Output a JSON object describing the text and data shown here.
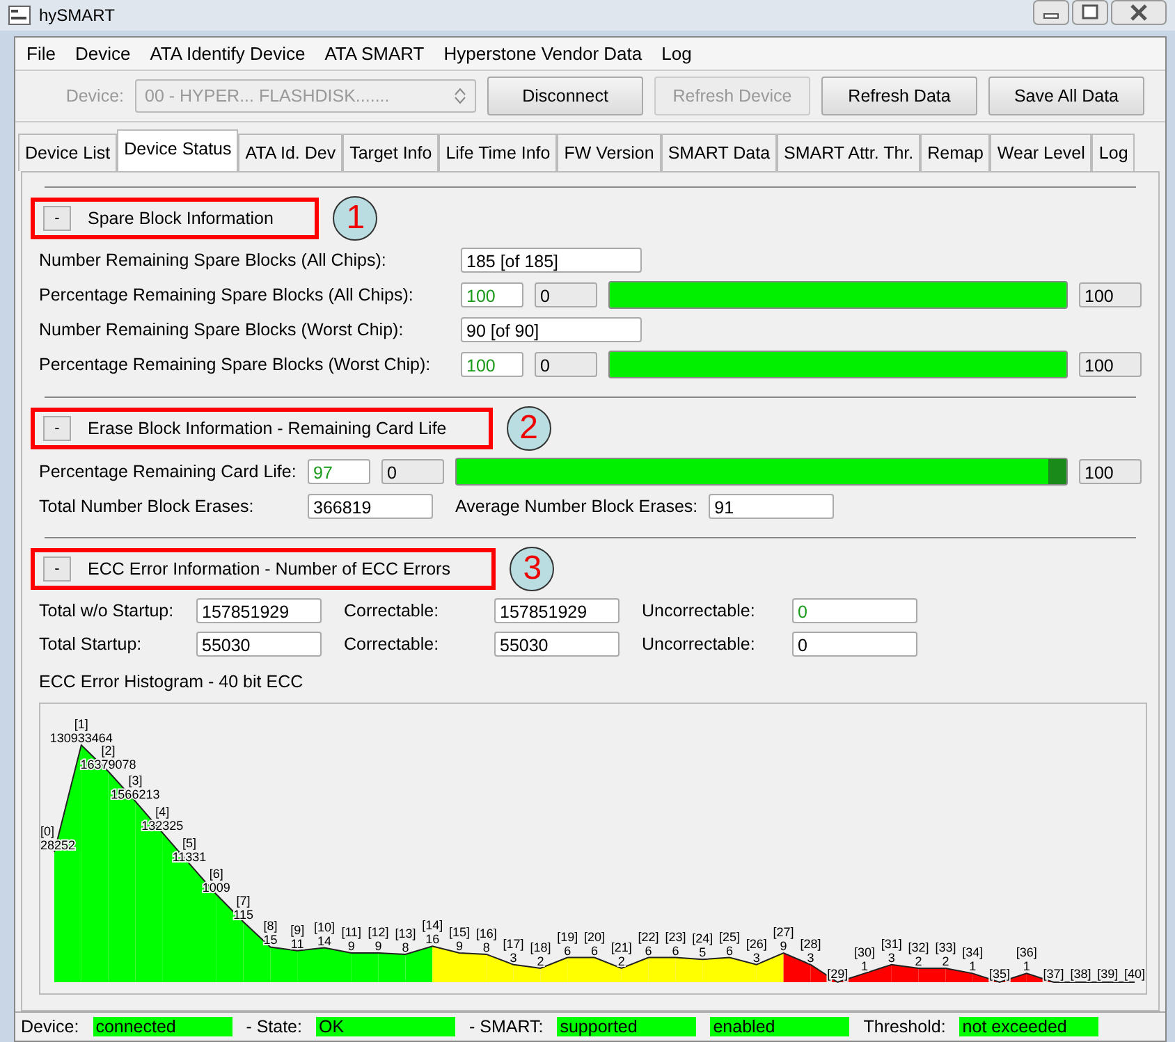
{
  "window": {
    "title": "hySMART"
  },
  "menu": [
    {
      "label": "File"
    },
    {
      "label": "Device"
    },
    {
      "label": "ATA Identify Device"
    },
    {
      "label": "ATA SMART"
    },
    {
      "label": "Hyperstone Vendor Data"
    },
    {
      "label": "Log"
    }
  ],
  "toolbar": {
    "device_label": "Device:",
    "device_value": "00 - HYPER... FLASHDISK.......",
    "device_disabled": true,
    "buttons": [
      {
        "label": "Disconnect",
        "disabled": false
      },
      {
        "label": "Refresh Device",
        "disabled": true
      },
      {
        "label": "Refresh Data",
        "disabled": false
      },
      {
        "label": "Save All Data",
        "disabled": false
      }
    ]
  },
  "tabs": [
    {
      "label": "Device List",
      "selected": false
    },
    {
      "label": "Device Status",
      "selected": true
    },
    {
      "label": "ATA Id. Dev",
      "selected": false
    },
    {
      "label": "Target Info",
      "selected": false
    },
    {
      "label": "Life Time Info",
      "selected": false
    },
    {
      "label": "FW Version",
      "selected": false
    },
    {
      "label": "SMART Data",
      "selected": false
    },
    {
      "label": "SMART Attr. Thr.",
      "selected": false
    },
    {
      "label": "Remap",
      "selected": false
    },
    {
      "label": "Wear Level",
      "selected": false
    },
    {
      "label": "Log",
      "selected": false
    }
  ],
  "sections": [
    {
      "toggle": "-",
      "title": "Spare Block Information",
      "badge": "1",
      "rows": [
        [
          {
            "kind": "label",
            "text": "Number Remaining Spare Blocks (All Chips):"
          },
          {
            "kind": "field",
            "text": "185 [of 185]"
          }
        ],
        [
          {
            "kind": "label",
            "text": "Percentage Remaining Spare Blocks (All Chips):"
          },
          {
            "kind": "small",
            "text": "100",
            "good": true
          },
          {
            "kind": "small",
            "text": "0",
            "good": false
          },
          {
            "kind": "bar",
            "level": 1
          },
          {
            "kind": "small",
            "text": "100",
            "good": false
          }
        ],
        [
          {
            "kind": "label",
            "text": "Number Remaining Spare Blocks (Worst Chip):"
          },
          {
            "kind": "field",
            "text": "90 [of 90]"
          }
        ],
        [
          {
            "kind": "label",
            "text": "Percentage Remaining Spare Blocks (Worst Chip):"
          },
          {
            "kind": "small",
            "text": "100",
            "good": true
          },
          {
            "kind": "small",
            "text": "0",
            "good": false
          },
          {
            "kind": "bar",
            "level": 1
          },
          {
            "kind": "small",
            "text": "100",
            "good": false
          }
        ]
      ]
    },
    {
      "toggle": "-",
      "title": "Erase Block Information - Remaining Card Life",
      "badge": "2",
      "rows": [
        [
          {
            "kind": "label",
            "text": "Percentage Remaining Card Life:"
          },
          {
            "kind": "small",
            "text": "97",
            "good": true
          },
          {
            "kind": "small",
            "text": "0",
            "good": false
          },
          {
            "kind": "bar",
            "level": 0.97
          },
          {
            "kind": "small",
            "text": "100",
            "good": false
          }
        ],
        [
          {
            "kind": "label",
            "text": "Total Number Block Erases:"
          },
          {
            "kind": "field",
            "text": "366819"
          },
          {
            "kind": "label2",
            "text": "Average Number Block Erases:"
          },
          {
            "kind": "field",
            "text": "91"
          }
        ]
      ]
    },
    {
      "toggle": "-",
      "title": "ECC Error Information - Number of ECC Errors",
      "badge": "3",
      "rows": [
        [
          {
            "kind": "label",
            "text": "Total w/o Startup:"
          },
          {
            "kind": "field",
            "text": "157851929"
          },
          {
            "kind": "label2",
            "text": "Correctable:"
          },
          {
            "kind": "field",
            "text": "157851929"
          },
          {
            "kind": "label2",
            "text": "Uncorrectable:"
          },
          {
            "kind": "field",
            "text": "0",
            "good": true
          }
        ],
        [
          {
            "kind": "label",
            "text": "Total Startup:"
          },
          {
            "kind": "field",
            "text": "55030"
          },
          {
            "kind": "label2",
            "text": "Correctable:"
          },
          {
            "kind": "field",
            "text": "55030"
          },
          {
            "kind": "label2",
            "text": "Uncorrectable:"
          },
          {
            "kind": "field",
            "text": "0",
            "good": false
          }
        ]
      ]
    }
  ],
  "histogram": {
    "title": "ECC Error Histogram - 40 bit ECC",
    "bins": [
      {
        "label": "[0]",
        "value": "28252",
        "color": "#00ff00"
      },
      {
        "label": "[1]",
        "value": "130933464",
        "color": "#00ff00"
      },
      {
        "label": "[2]",
        "value": "16379078",
        "color": "#00ff00"
      },
      {
        "label": "[3]",
        "value": "1566213",
        "color": "#00ff00"
      },
      {
        "label": "[4]",
        "value": "132325",
        "color": "#00ff00"
      },
      {
        "label": "[5]",
        "value": "11331",
        "color": "#00ff00"
      },
      {
        "label": "[6]",
        "value": "1009",
        "color": "#00ff00"
      },
      {
        "label": "[7]",
        "value": "115",
        "color": "#00ff00"
      },
      {
        "label": "[8]",
        "value": "15",
        "color": "#00ff00"
      },
      {
        "label": "[9]",
        "value": "11",
        "color": "#00ff00"
      },
      {
        "label": "[10]",
        "value": "14",
        "color": "#00ff00"
      },
      {
        "label": "[11]",
        "value": "9",
        "color": "#00ff00"
      },
      {
        "label": "[12]",
        "value": "9",
        "color": "#00ff00"
      },
      {
        "label": "[13]",
        "value": "8",
        "color": "#00ff00"
      },
      {
        "label": "[14]",
        "value": "16",
        "color": "#ffff00"
      },
      {
        "label": "[15]",
        "value": "9",
        "color": "#ffff00"
      },
      {
        "label": "[16]",
        "value": "8",
        "color": "#ffff00"
      },
      {
        "label": "[17]",
        "value": "3",
        "color": "#ffff00"
      },
      {
        "label": "[18]",
        "value": "2",
        "color": "#ffff00"
      },
      {
        "label": "[19]",
        "value": "6",
        "color": "#ffff00"
      },
      {
        "label": "[20]",
        "value": "6",
        "color": "#ffff00"
      },
      {
        "label": "[21]",
        "value": "2",
        "color": "#ffff00"
      },
      {
        "label": "[22]",
        "value": "6",
        "color": "#ffff00"
      },
      {
        "label": "[23]",
        "value": "6",
        "color": "#ffff00"
      },
      {
        "label": "[24]",
        "value": "5",
        "color": "#ffff00"
      },
      {
        "label": "[25]",
        "value": "6",
        "color": "#ffff00"
      },
      {
        "label": "[26]",
        "value": "3",
        "color": "#ffff00"
      },
      {
        "label": "[27]",
        "value": "9",
        "color": "#ff0000"
      },
      {
        "label": "[28]",
        "value": "3",
        "color": "#ff0000"
      },
      {
        "label": "[29]",
        "color": "#ff0000"
      },
      {
        "label": "[30]",
        "value": "1",
        "color": "#ff0000"
      },
      {
        "label": "[31]",
        "value": "3",
        "color": "#ff0000"
      },
      {
        "label": "[32]",
        "value": "2",
        "color": "#ff0000"
      },
      {
        "label": "[33]",
        "value": "2",
        "color": "#ff0000"
      },
      {
        "label": "[34]",
        "value": "1",
        "color": "#ff0000"
      },
      {
        "label": "[35]",
        "color": "#ff0000"
      },
      {
        "label": "[36]",
        "value": "1",
        "color": "#ff0000"
      },
      {
        "label": "[37]"
      },
      {
        "label": "[38]"
      },
      {
        "label": "[39]"
      },
      {
        "label": "[40]"
      }
    ]
  },
  "status_bar": [
    {
      "kind": "label",
      "text": "Device:"
    },
    {
      "kind": "value",
      "text": "connected",
      "ok": true
    },
    {
      "kind": "label",
      "text": "- State:"
    },
    {
      "kind": "value",
      "text": "OK",
      "ok": true
    },
    {
      "kind": "label",
      "text": "- SMART:"
    },
    {
      "kind": "value",
      "text": "supported",
      "ok": true
    },
    {
      "kind": "value",
      "text": "enabled",
      "ok": true
    },
    {
      "kind": "label",
      "text": "Threshold:"
    },
    {
      "kind": "value",
      "text": "not exceeded",
      "ok": true
    }
  ]
}
